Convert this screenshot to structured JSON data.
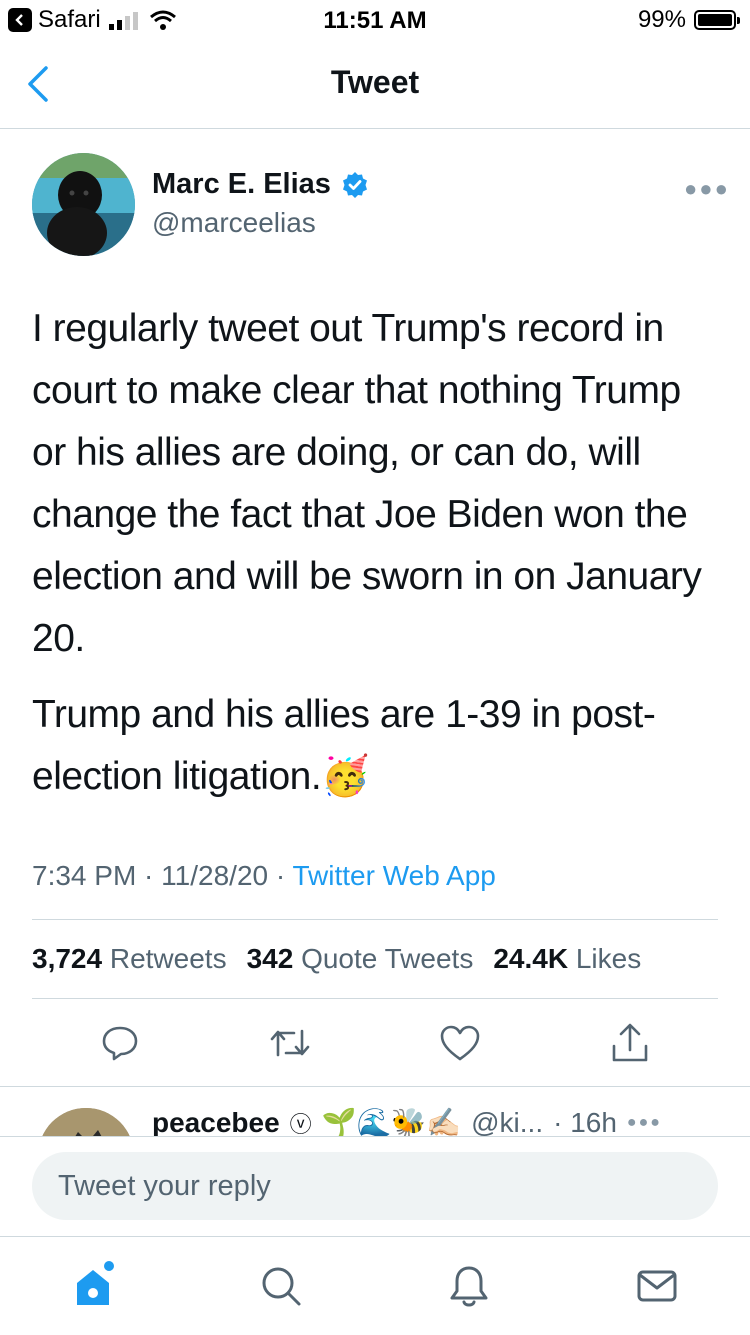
{
  "status_bar": {
    "back_app": "Safari",
    "time": "11:51 AM",
    "battery": "99%",
    "battery_level": 0.99
  },
  "nav": {
    "title": "Tweet"
  },
  "tweet": {
    "author_name": "Marc E. Elias",
    "handle": "@marceelias",
    "paragraphs": [
      "I regularly tweet out Trump's record in court to make clear that nothing Trump or his allies are doing, or can do, will change the fact that Joe Biden won the election and will be sworn in on January 20.",
      "Trump and his allies are 1-39 in post-election litigation."
    ],
    "emoji": "🥳",
    "time": "7:34 PM",
    "date": "11/28/20",
    "source": "Twitter Web App",
    "retweets": "3,724",
    "retweets_label": "Retweets",
    "quote_tweets": "342",
    "quote_tweets_label": "Quote Tweets",
    "likes": "24.4K",
    "likes_label": "Likes"
  },
  "reply_preview": {
    "name": "peacebee",
    "emojis": "🌱🌊🐝✍🏻",
    "handle": "@ki...",
    "time": "· 16h"
  },
  "compose": {
    "placeholder": "Tweet your reply"
  },
  "colors": {
    "accent": "#1d9bf0",
    "secondary_text": "#536471",
    "divider": "#cfd9de"
  },
  "icons": [
    "back-chevron-icon",
    "verified-badge-icon",
    "more-icon",
    "reply-icon",
    "retweet-icon",
    "like-icon",
    "share-icon",
    "home-icon",
    "search-icon",
    "notifications-icon",
    "messages-icon"
  ]
}
